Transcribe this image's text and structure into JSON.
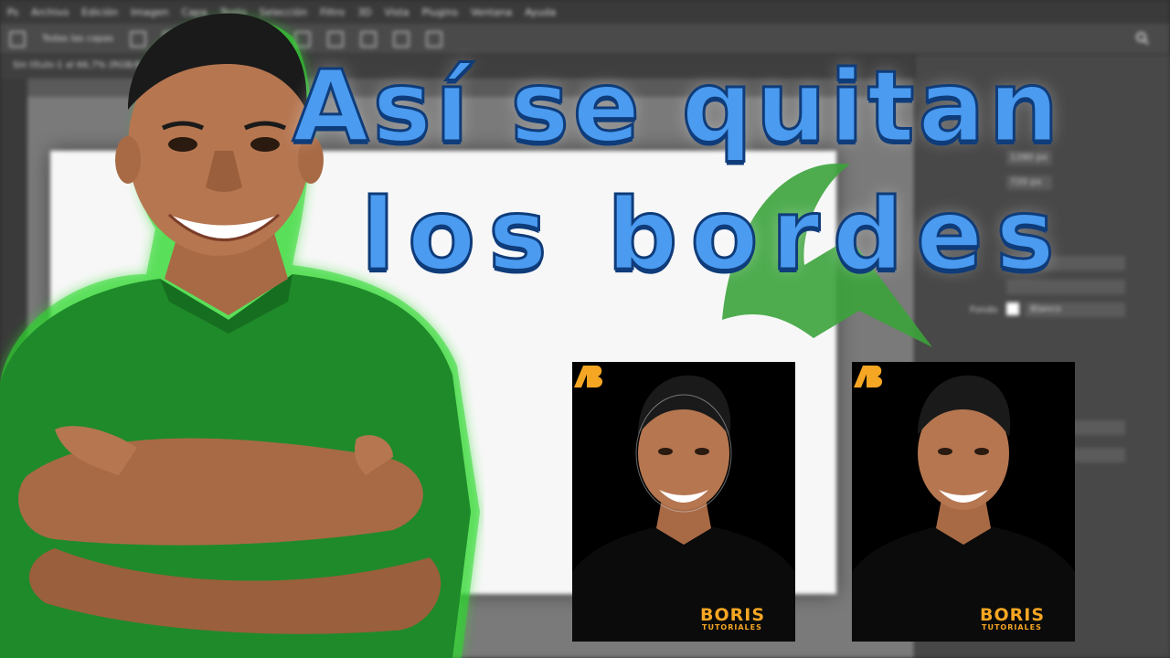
{
  "background_app": {
    "menu": [
      "Ps",
      "Archivo",
      "Edición",
      "Imagen",
      "Capa",
      "Texto",
      "Selección",
      "Filtro",
      "3D",
      "Vista",
      "Plugins",
      "Ventana",
      "Ayuda"
    ],
    "options_text": "Todas las capas",
    "tab_title": "Sin título-1 al 66,7% (RGB/8#)",
    "panel_labels": {
      "w": "1280 px",
      "h": "720 px",
      "fondo_label": "Fondo",
      "fondo_value": "Blanco"
    }
  },
  "headline": {
    "line1": "Así se quitan",
    "line2": "los bordes",
    "color": "#4b9bf0",
    "outline": "#0f3c7a"
  },
  "accent_green": "#3ba33b",
  "thumbnails": [
    {
      "name": "before",
      "brand": "BORIS",
      "brand_sub": "TUTORIALES"
    },
    {
      "name": "after",
      "brand": "BORIS",
      "brand_sub": "TUTORIALES"
    }
  ],
  "brand_color": "#f5a623"
}
